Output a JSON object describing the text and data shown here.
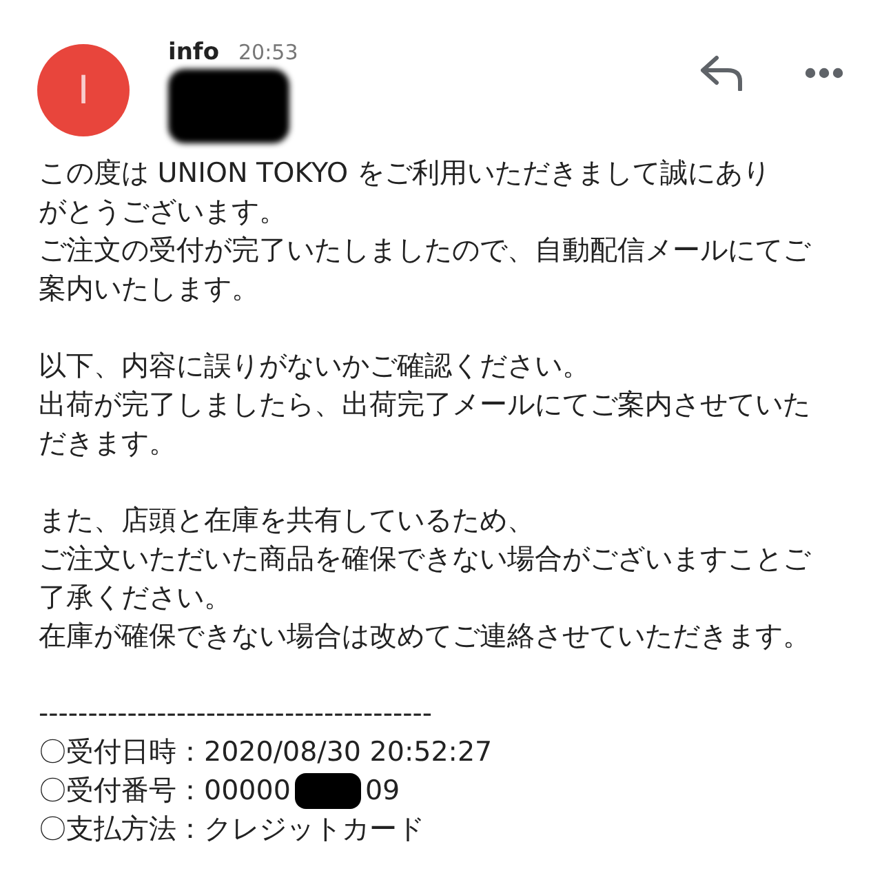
{
  "sender": {
    "avatar_letter": "I",
    "name": "info",
    "time": "20:53"
  },
  "body": [
    {
      "kind": "paragraph",
      "lines": [
        "この度は UNION TOKYO をご利用いただきまして誠にあり",
        "がとうございます。",
        "ご注文の受付が完了いたしましたので、自動配信メールにてご",
        "案内いたします。"
      ]
    },
    {
      "kind": "paragraph",
      "lines": [
        "以下、内容に誤りがないかご確認ください。",
        "出荷が完了しましたら、出荷完了メールにてご案内させていた",
        "だきます。"
      ]
    },
    {
      "kind": "paragraph",
      "lines": [
        "また、店頭と在庫を共有しているため、",
        "ご注文いただいた商品を確保できない場合がございますことご",
        "了承ください。",
        "在庫が確保できない場合は改めてご連絡させていただきます。"
      ]
    },
    {
      "kind": "details",
      "separator": "----------------------------------------",
      "fields": [
        {
          "label": "〇受付日時：",
          "value": "2020/08/30 20:52:27"
        },
        {
          "label": "〇受付番号：",
          "value": "00000",
          "value_end": "09",
          "redacted": true
        },
        {
          "label": "〇支払方法：",
          "value": "クレジットカード"
        }
      ]
    }
  ]
}
